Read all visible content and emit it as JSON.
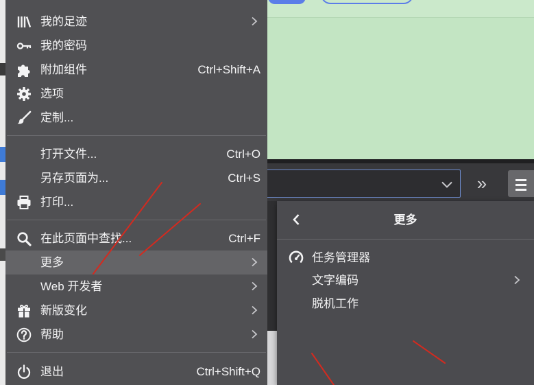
{
  "colors": {
    "menu_bg": "#505053",
    "menu_hover": "#646467",
    "menu_text": "#f4f4f5",
    "separator": "#69696d",
    "page_bg": "#c3e5c3",
    "toolbar_bg": "#38383b",
    "panel_bg": "#4b4b4f",
    "accent_blue": "#5b7de8",
    "field_border": "#6e8dcf",
    "annotation_red": "#d42a1f",
    "chevron": "#c8c8cc"
  },
  "main_menu": {
    "items": [
      {
        "label": "我的足迹",
        "icon": "library-icon",
        "has_submenu": true
      },
      {
        "label": "我的密码",
        "icon": "key-icon",
        "has_submenu": false
      },
      {
        "label": "附加组件",
        "icon": "puzzle-icon",
        "shortcut": "Ctrl+Shift+A",
        "has_submenu": false
      },
      {
        "label": "选项",
        "icon": "gear-icon",
        "has_submenu": false
      },
      {
        "label": "定制...",
        "icon": "brush-icon",
        "has_submenu": false
      },
      {
        "label": "打开文件...",
        "shortcut": "Ctrl+O",
        "has_submenu": false
      },
      {
        "label": "另存页面为...",
        "shortcut": "Ctrl+S",
        "has_submenu": false
      },
      {
        "label": "打印...",
        "icon": "printer-icon",
        "has_submenu": false
      },
      {
        "label": "在此页面中查找...",
        "icon": "search-icon",
        "shortcut": "Ctrl+F",
        "has_submenu": false
      },
      {
        "label": "更多",
        "has_submenu": true,
        "highlighted": true
      },
      {
        "label": "Web 开发者",
        "has_submenu": true
      },
      {
        "label": "新版变化",
        "icon": "gift-icon",
        "has_submenu": true
      },
      {
        "label": "帮助",
        "icon": "help-icon",
        "has_submenu": true
      },
      {
        "label": "退出",
        "icon": "power-icon",
        "shortcut": "Ctrl+Shift+Q",
        "has_submenu": false
      }
    ]
  },
  "toolbar": {
    "dropdown_icon": "chevron-down-icon",
    "overflow_label": "»",
    "menu_button_icon": "hamburger-menu-icon"
  },
  "more_panel": {
    "back_icon": "chevron-left-icon",
    "title": "更多",
    "items": [
      {
        "label": "任务管理器",
        "icon": "gauge-icon",
        "has_submenu": false
      },
      {
        "label": "文字编码",
        "has_submenu": true
      },
      {
        "label": "脱机工作",
        "has_submenu": false
      }
    ]
  }
}
